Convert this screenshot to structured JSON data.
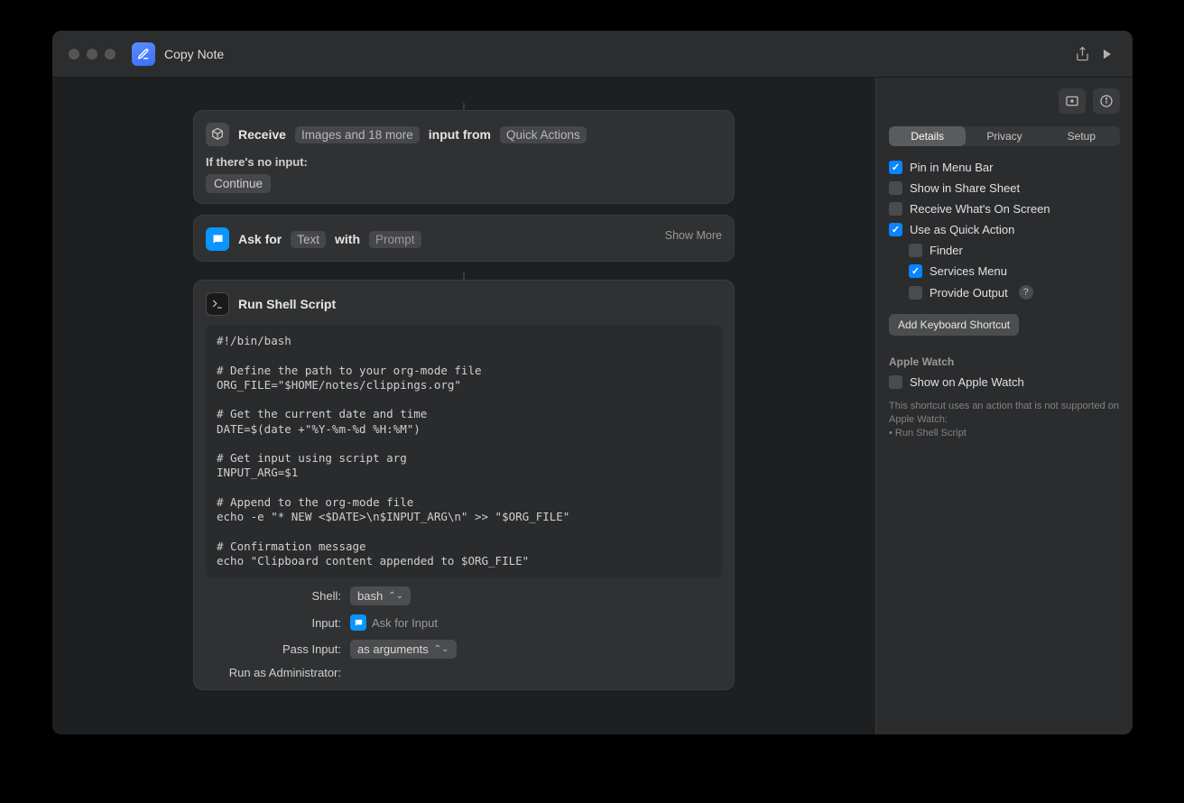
{
  "window": {
    "title": "Copy Note"
  },
  "titlebar": {
    "share_icon": "share-icon",
    "play_icon": "play-icon"
  },
  "sidebar": {
    "add_panel_icon": "add-panel-icon",
    "info_icon": "info-icon",
    "tabs": [
      "Details",
      "Privacy",
      "Setup"
    ],
    "active_tab": 0,
    "options": [
      {
        "label": "Pin in Menu Bar",
        "checked": true
      },
      {
        "label": "Show in Share Sheet",
        "checked": false
      },
      {
        "label": "Receive What's On Screen",
        "checked": false
      },
      {
        "label": "Use as Quick Action",
        "checked": true
      }
    ],
    "quick_action_subs": [
      {
        "label": "Finder",
        "checked": false
      },
      {
        "label": "Services Menu",
        "checked": true
      },
      {
        "label": "Provide Output",
        "checked": false,
        "help": "?"
      }
    ],
    "add_shortcut": "Add Keyboard Shortcut",
    "watch_header": "Apple Watch",
    "watch_option": {
      "label": "Show on Apple Watch",
      "checked": false
    },
    "watch_note_line1": "This shortcut uses an action that is not supported on Apple Watch:",
    "watch_note_bullet": "• Run Shell Script"
  },
  "actions": {
    "receive": {
      "title": "Receive",
      "types_token": "Images and 18 more",
      "middle": "input from",
      "source_token": "Quick Actions",
      "no_input_label": "If there's no input:",
      "continue": "Continue"
    },
    "ask": {
      "lead": "Ask for",
      "type_token": "Text",
      "with": "with",
      "prompt_token": "Prompt",
      "show_more": "Show More"
    },
    "shell": {
      "title": "Run Shell Script",
      "code": "#!/bin/bash\n\n# Define the path to your org-mode file\nORG_FILE=\"$HOME/notes/clippings.org\"\n\n# Get the current date and time\nDATE=$(date +\"%Y-%m-%d %H:%M\")\n\n# Get input using script arg\nINPUT_ARG=$1\n\n# Append to the org-mode file\necho -e \"* NEW <$DATE>\\n$INPUT_ARG\\n\" >> \"$ORG_FILE\"\n\n# Confirmation message\necho \"Clipboard content appended to $ORG_FILE\"",
      "form": {
        "shell_label": "Shell:",
        "shell_value": "bash",
        "input_label": "Input:",
        "input_value": "Ask for Input",
        "pass_label": "Pass Input:",
        "pass_value": "as arguments",
        "admin_label": "Run as Administrator:",
        "admin_checked": false
      }
    }
  }
}
